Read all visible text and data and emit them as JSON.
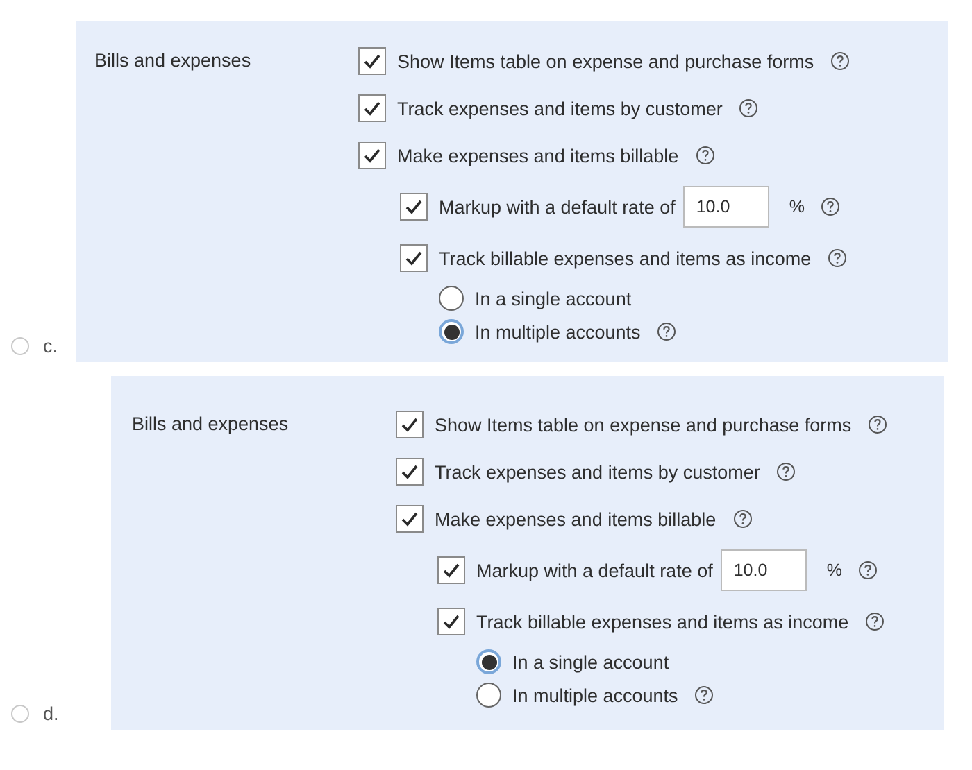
{
  "options": [
    {
      "label": "c.",
      "selected": false,
      "panel": {
        "heading": "Bills and expenses",
        "settings": [
          {
            "kind": "checkbox",
            "label": "Show Items table on expense and purchase forms",
            "checked": true,
            "help": true
          },
          {
            "kind": "checkbox",
            "label": "Track expenses and items by customer",
            "checked": true,
            "help": true
          },
          {
            "kind": "checkbox",
            "label": "Make expenses and items billable",
            "checked": true,
            "help": true,
            "children": [
              {
                "kind": "markup",
                "label": "Markup with a default rate of",
                "checked": true,
                "value": "10.0",
                "unit": "%",
                "help": true
              },
              {
                "kind": "checkbox",
                "label": "Track billable expenses and items as income",
                "checked": true,
                "help": true,
                "children": [
                  {
                    "kind": "radio",
                    "label": "In a single account",
                    "selected": false,
                    "help": false
                  },
                  {
                    "kind": "radio",
                    "label": "In multiple accounts",
                    "selected": true,
                    "help": true
                  }
                ]
              }
            ]
          }
        ]
      }
    },
    {
      "label": "d.",
      "selected": false,
      "panel": {
        "heading": "Bills and expenses",
        "settings": [
          {
            "kind": "checkbox",
            "label": "Show Items table on expense and purchase forms",
            "checked": true,
            "help": true
          },
          {
            "kind": "checkbox",
            "label": "Track expenses and items by customer",
            "checked": true,
            "help": true
          },
          {
            "kind": "checkbox",
            "label": "Make expenses and items billable",
            "checked": true,
            "help": true,
            "children": [
              {
                "kind": "markup",
                "label": "Markup with a default rate of",
                "checked": true,
                "value": "10.0",
                "unit": "%",
                "help": true
              },
              {
                "kind": "checkbox",
                "label": "Track billable expenses and items as income",
                "checked": true,
                "help": true,
                "children": [
                  {
                    "kind": "radio",
                    "label": "In a single account",
                    "selected": true,
                    "help": false
                  },
                  {
                    "kind": "radio",
                    "label": "In multiple accounts",
                    "selected": false,
                    "help": true
                  }
                ]
              }
            ]
          }
        ]
      }
    }
  ]
}
